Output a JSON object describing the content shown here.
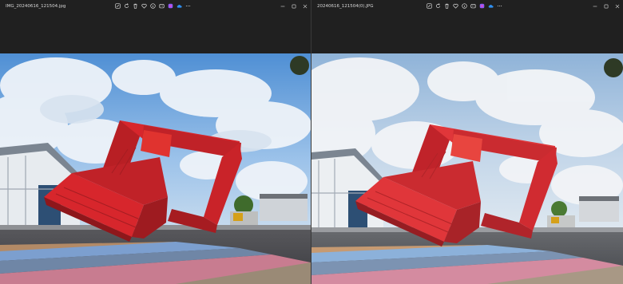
{
  "windows": [
    {
      "id": "left",
      "filename": "IMG_20240616_121504.jpg",
      "toolbar_icons": [
        "edit-icon",
        "rotate-icon",
        "delete-icon",
        "favorite-icon",
        "info-icon",
        "share-icon",
        "copilot-icon",
        "onedrive-icon",
        "more-icon"
      ],
      "window_controls": [
        "minimize-icon",
        "maximize-icon",
        "close-icon"
      ]
    },
    {
      "id": "right",
      "filename": "20240616_121504(0).JPG",
      "toolbar_icons": [
        "edit-icon",
        "rotate-icon",
        "delete-icon",
        "favorite-icon",
        "info-icon",
        "share-icon",
        "copilot-icon",
        "onedrive-icon",
        "more-icon"
      ],
      "window_controls": [
        "minimize-icon",
        "maximize-icon",
        "close-icon"
      ]
    }
  ],
  "colors": {
    "chrome_bg": "#202020",
    "title_text": "#d8d8d8",
    "container_red": "#d7262c",
    "copilot_accent": "#8a5cf6",
    "onedrive_accent": "#2f8ff0"
  }
}
